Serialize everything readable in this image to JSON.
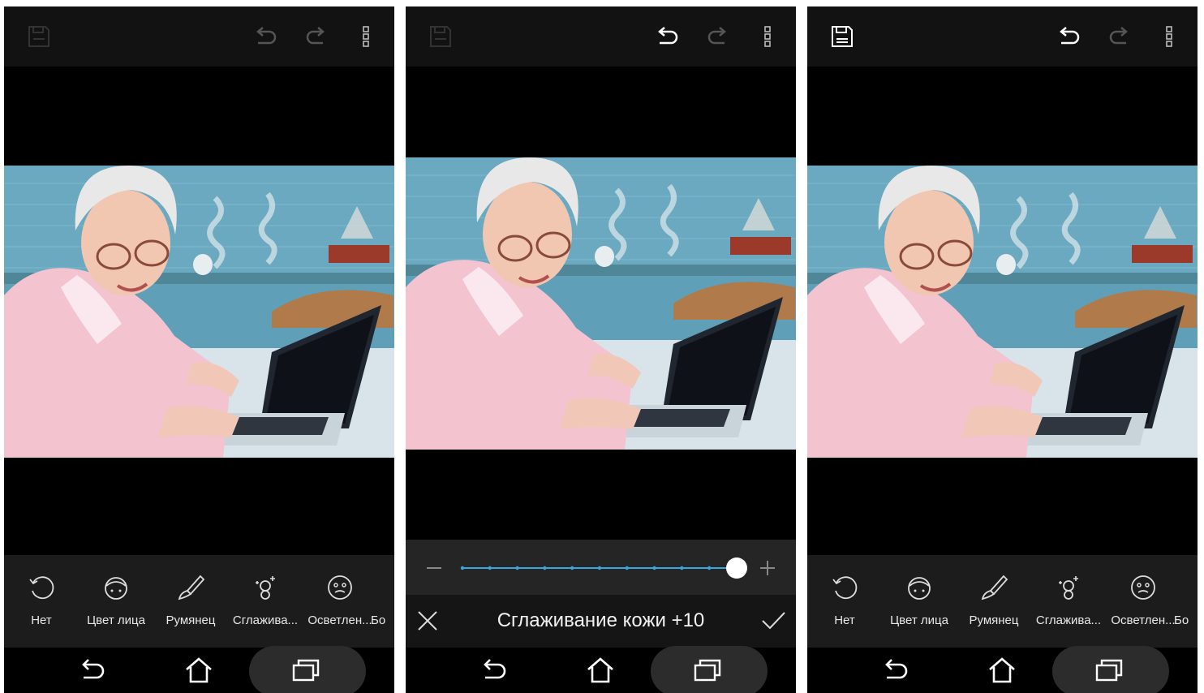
{
  "screens": [
    {
      "id": "before",
      "toolbar": {
        "save_icon": "save-icon",
        "undo_icon": "undo-icon",
        "redo_icon": "redo-icon",
        "more_icon": "more-vertical-icon"
      },
      "tools": [
        {
          "label": "Нет",
          "icon": "reset-icon"
        },
        {
          "label": "Цвет лица",
          "icon": "face-tone-icon"
        },
        {
          "label": "Румянец",
          "icon": "blush-brush-icon"
        },
        {
          "label": "Сглажива...",
          "icon": "smoothing-icon"
        },
        {
          "label": "Осветлен...",
          "icon": "brighten-face-icon"
        },
        {
          "label": "Бо",
          "icon": "more-tool"
        }
      ]
    },
    {
      "id": "editing",
      "caption": "Сглаживание кожи +10",
      "slider": {
        "value_fraction": 1.0,
        "steps": 10,
        "minus_icon": "minus-icon",
        "plus_icon": "plus-icon"
      },
      "cancel_icon": "close-icon",
      "confirm_icon": "check-icon"
    },
    {
      "id": "after",
      "tools": [
        {
          "label": "Нет",
          "icon": "reset-icon"
        },
        {
          "label": "Цвет лица",
          "icon": "face-tone-icon"
        },
        {
          "label": "Румянец",
          "icon": "blush-brush-icon"
        },
        {
          "label": "Сглажива...",
          "icon": "smoothing-icon"
        },
        {
          "label": "Осветлен...",
          "icon": "brighten-face-icon"
        },
        {
          "label": "Бо",
          "icon": "more-tool"
        }
      ]
    }
  ],
  "navigation": {
    "back_icon": "back-icon",
    "home_icon": "home-icon",
    "recents_icon": "recents-icon"
  },
  "colors": {
    "slider_accent": "#3aa6dc",
    "toolbar_bg": "#121212",
    "panel_bg": "#1c1c1c"
  }
}
